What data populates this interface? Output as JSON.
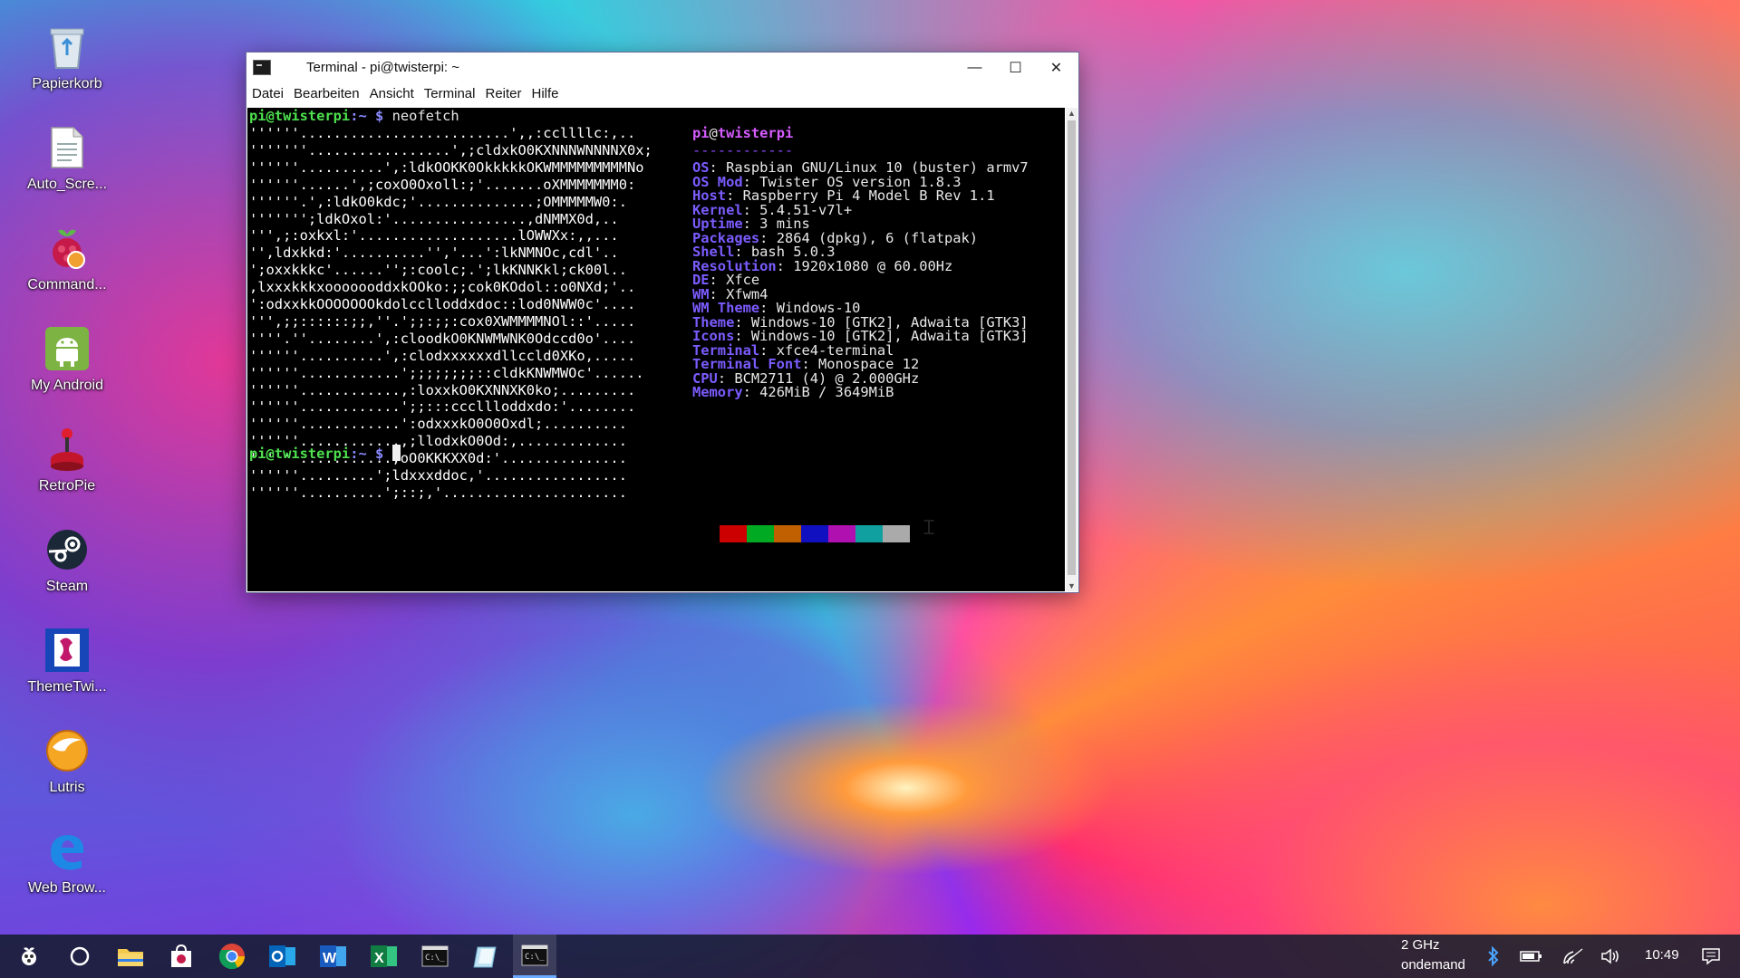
{
  "desktop": {
    "icons": [
      {
        "label": "Papierkorb",
        "icon": "recycle-bin-icon"
      },
      {
        "label": "Auto_Scre...",
        "icon": "text-file-icon"
      },
      {
        "label": "Command...",
        "icon": "raspberry-pi-icon"
      },
      {
        "label": "My Android",
        "icon": "android-icon"
      },
      {
        "label": "RetroPie",
        "icon": "retropie-joystick-icon"
      },
      {
        "label": "Steam",
        "icon": "steam-icon"
      },
      {
        "label": "ThemeTwi...",
        "icon": "themetwister-icon"
      },
      {
        "label": "Lutris",
        "icon": "lutris-icon"
      },
      {
        "label": "Web Brow...",
        "icon": "edge-icon"
      }
    ]
  },
  "window": {
    "title": "Terminal - pi@twisterpi: ~",
    "controls": {
      "minimize": "—",
      "maximize": "☐",
      "close": "✕"
    },
    "menu": [
      "Datei",
      "Bearbeiten",
      "Ansicht",
      "Terminal",
      "Reiter",
      "Hilfe"
    ]
  },
  "terminal": {
    "prompt_user": "pi@twisterpi",
    "prompt_path": ":~ $",
    "command": "neofetch",
    "logo": [
      "''''''.........................',,:ccllllc:,..",
      "'''''''.................',;cldxkO0KXNNNWNNNNX0x;",
      "''''''..........',:ldkOOKK0OkkkkkOKWMMMMMMMMMNo",
      "''''''......',;coxO0Oxoll:;'.......oXMMMMMMM0:",
      "''''''.',:ldkO0kdc;'..............;OMMMMMW0:.",
      "''''''';ldkOxol:'................,dNMMX0d,..",
      "''',;:oxkxl:'...................lOWWXx:,,...",
      "'',ldxkkd:'..........'','...':lkNMNOc,cdl'..",
      "';oxxkkkc'......'';:coolc;.';lkKNNKkl;ck00l..",
      ",lxxxkkkxooooooddxkOOko:;;cok0KOdol::o0NXd;'..",
      "':odxxkkOOOOOOOkdolcclloddxdoc::lod0NWW0c'....",
      "''',;;::::::;;,''.';;:;;:cox0XWMMMMNOl::'.....",
      "''''.''........',:cloodkO0KNWMWNK0Odccd0o'....",
      "''''''..........',:clodxxxxxxdllccld0XKo,.....",
      "''''''............';;;;;;;;::cldkKNWMWOc'......",
      "''''''............,:loxxkO0KXNNXK0ko;.........",
      "''''''............';;:::cccllloddxdo:'........",
      "''''''............':odxxxkO0O0Oxdl;..........",
      "''''''............,;llodxkO0Od:,.............",
      "''''''...........,oO0KKKXX0d:'...............",
      "''''''.........';ldxxxddoc,'.................",
      "''''''..........';::;,'......................"
    ],
    "info_user": "pi",
    "info_at": "@",
    "info_host": "twisterpi",
    "separator": "------------",
    "info": [
      {
        "key": "OS",
        "value": "Raspbian GNU/Linux 10 (buster) armv7"
      },
      {
        "key": "OS Mod",
        "value": "Twister OS version 1.8.3"
      },
      {
        "key": "Host",
        "value": "Raspberry Pi 4 Model B Rev 1.1"
      },
      {
        "key": "Kernel",
        "value": "5.4.51-v7l+"
      },
      {
        "key": "Uptime",
        "value": "3 mins"
      },
      {
        "key": "Packages",
        "value": "2864 (dpkg), 6 (flatpak)"
      },
      {
        "key": "Shell",
        "value": "bash 5.0.3"
      },
      {
        "key": "Resolution",
        "value": "1920x1080 @ 60.00Hz"
      },
      {
        "key": "DE",
        "value": "Xfce"
      },
      {
        "key": "WM",
        "value": "Xfwm4"
      },
      {
        "key": "WM Theme",
        "value": "Windows-10"
      },
      {
        "key": "Theme",
        "value": "Windows-10 [GTK2], Adwaita [GTK3]"
      },
      {
        "key": "Icons",
        "value": "Windows-10 [GTK2], Adwaita [GTK3]"
      },
      {
        "key": "Terminal",
        "value": "xfce4-terminal"
      },
      {
        "key": "Terminal Font",
        "value": "Monospace 12"
      },
      {
        "key": "CPU",
        "value": "BCM2711 (4) @ 2.000GHz"
      },
      {
        "key": "Memory",
        "value": "426MiB / 3649MiB"
      }
    ],
    "palette": [
      "#000000",
      "#cc0000",
      "#00aa22",
      "#c06000",
      "#1010c0",
      "#b010b0",
      "#10a0a0",
      "#aaaaaa"
    ]
  },
  "taskbar": {
    "items": [
      {
        "name": "start-button",
        "icon": "raspberry-start-icon"
      },
      {
        "name": "search-button",
        "icon": "cortana-circle-icon"
      },
      {
        "name": "file-explorer",
        "icon": "folder-icon"
      },
      {
        "name": "store",
        "icon": "store-bag-icon"
      },
      {
        "name": "chrome",
        "icon": "chrome-icon"
      },
      {
        "name": "outlook",
        "icon": "outlook-icon"
      },
      {
        "name": "word",
        "icon": "word-icon"
      },
      {
        "name": "excel",
        "icon": "excel-icon"
      },
      {
        "name": "command-prompt",
        "icon": "terminal-icon"
      },
      {
        "name": "notes",
        "icon": "notepad-icon"
      },
      {
        "name": "terminal-active",
        "icon": "terminal-icon"
      }
    ],
    "cpu_freq": "2 GHz",
    "cpu_governor": "ondemand",
    "clock": "10:49"
  }
}
